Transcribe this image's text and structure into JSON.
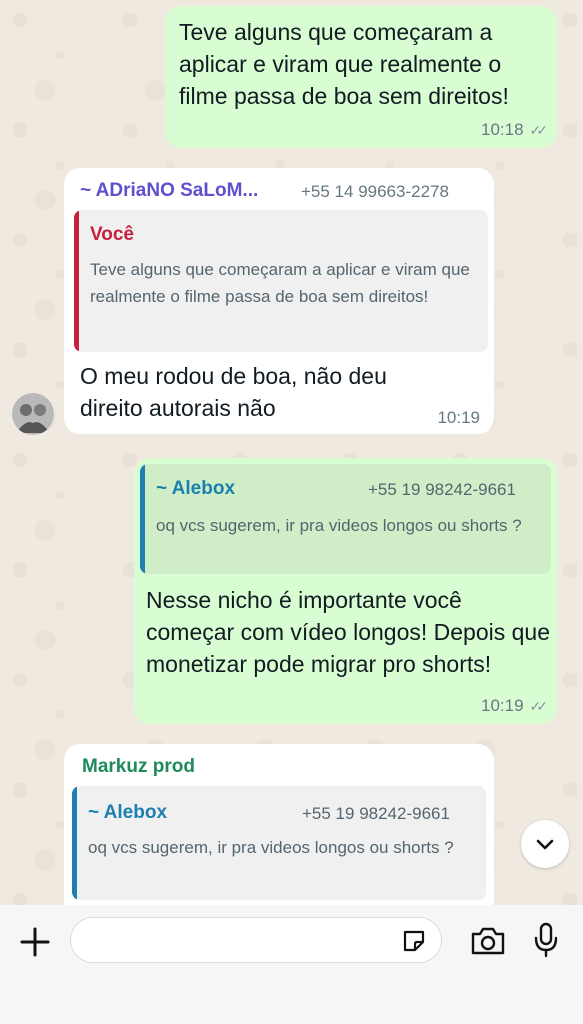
{
  "messages": [
    {
      "type": "outgoing",
      "text": "Teve alguns que começaram a aplicar e viram que realmente o filme passa de boa sem direitos!",
      "time": "10:18",
      "read": "✓✓"
    },
    {
      "type": "incoming",
      "sender": "~ ADriaNO SaLoM...",
      "phone": "+55 14 99663-2278",
      "quote": {
        "author": "Você",
        "text": "Teve alguns que começaram a aplicar e viram que realmente o filme passa de boa sem direitos!"
      },
      "text": "O meu rodou de boa, não deu direito autorais não",
      "time": "10:19"
    },
    {
      "type": "outgoing",
      "quote": {
        "author": "~ Alebox",
        "phone": "+55 19 98242-9661",
        "text": "oq vcs sugerem, ir pra videos longos ou shorts ?"
      },
      "text": "Nesse nicho é importante você começar com vídeo longos! Depois que monetizar pode migrar pro shorts!",
      "time": "10:19",
      "read": "✓✓"
    },
    {
      "type": "incoming",
      "sender": "Markuz prod",
      "quote": {
        "author": "~ Alebox",
        "phone": "+55 19 98242-9661",
        "text": "oq vcs sugerem, ir pra videos longos ou shorts ?"
      }
    }
  ],
  "colors": {
    "out_bubble": "#d9fdd3",
    "in_bubble": "#ffffff",
    "read_tick": "#53bdeb",
    "adriano": "#5f4fd1",
    "voce": "#c8203f",
    "alebox": "#1c7fb0",
    "markuz": "#1f8a5c"
  },
  "composer": {
    "placeholder": ""
  },
  "icons": {
    "add": "plus-icon",
    "sticker": "sticker-icon",
    "camera": "camera-icon",
    "mic": "mic-icon",
    "scroll": "chevron-down-icon"
  }
}
